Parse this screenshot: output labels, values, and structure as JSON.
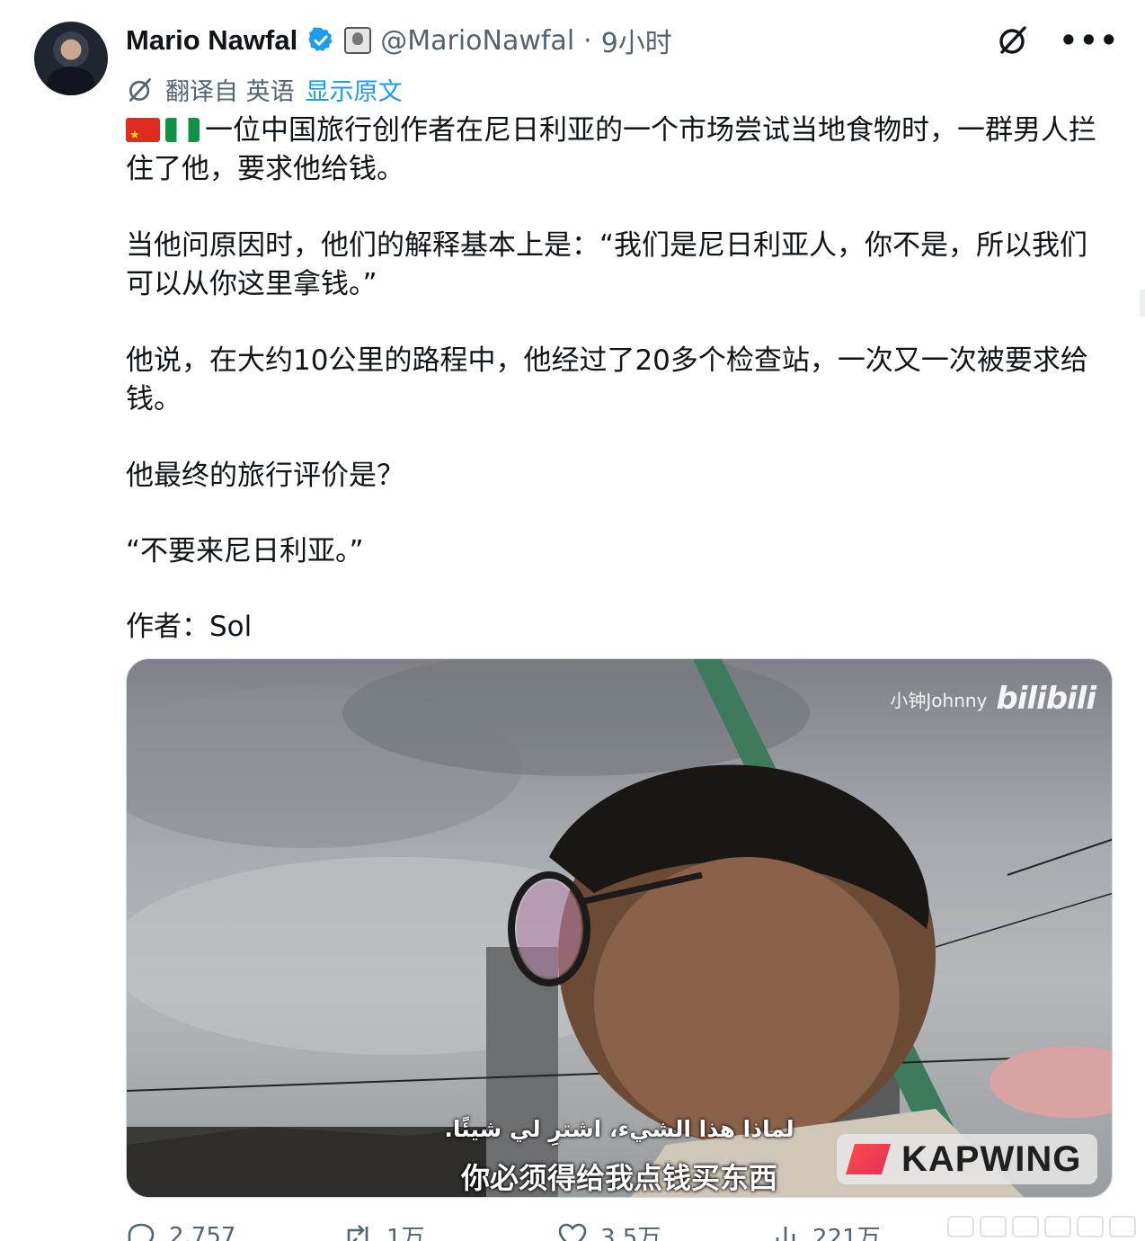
{
  "author": {
    "name": "Mario Nawfal",
    "handle": "@MarioNawfal",
    "separator": "·",
    "time": "9小时",
    "verified_icon": "verified-badge-icon",
    "affiliation_icon": "affiliation-badge-icon"
  },
  "translation": {
    "label": "翻译自 英语",
    "show_original": "显示原文"
  },
  "tweet": {
    "line1": "一位中国旅行创作者在尼日利亚的一个市场尝试当地食物时，一群男人拦住了他，要求他给钱。",
    "line2": "当他问原因时，他们的解释基本上是：“我们是尼日利亚人，你不是，所以我们可以从你这里拿钱。”",
    "line3": "他说，在大约10公里的路程中，他经过了20多个检查站，一次又一次被要求给钱。",
    "line4": "他最终的旅行评价是？",
    "line5": "“不要来尼日利亚。”",
    "line6": "作者：Sol",
    "flags": [
      "china-flag",
      "nigeria-flag"
    ]
  },
  "media": {
    "watermark_user": "小钟Johnny",
    "watermark_logo": "bilibili",
    "subtitle_ar": "لماذا هذا الشيء، اشترِ لي شيئًا.",
    "subtitle_zh": "你必须得给我点钱买东西",
    "kapwing": "KAPWING"
  },
  "actions": {
    "reply_count": "2,757",
    "retweet_count": "1万",
    "like_count": "3.5万",
    "views_count": "221万"
  },
  "colors": {
    "link": "#1d9bf0",
    "secondary_text": "#536471",
    "verified": "#1d9bf0"
  }
}
